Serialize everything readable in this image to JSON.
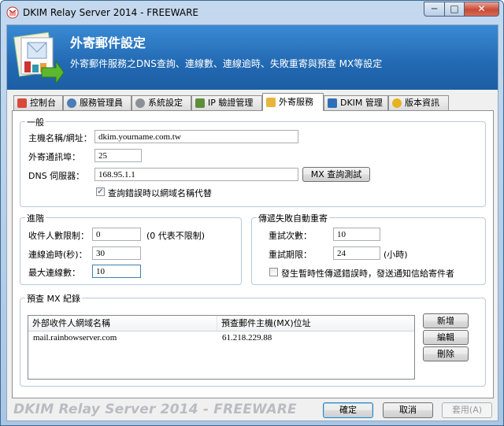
{
  "window": {
    "title": "DKIM Relay Server 2014 - FREEWARE",
    "min_glyph": "─",
    "max_glyph": "□",
    "close_glyph": "✕"
  },
  "banner": {
    "title": "外寄郵件設定",
    "subtitle": "外寄郵件服務之DNS查詢、連線數、連線逾時、失敗重寄與預查 MX等設定"
  },
  "tabs": [
    {
      "label": "控制台",
      "icon": "console-icon"
    },
    {
      "label": "服務管理員",
      "icon": "service-manager-icon"
    },
    {
      "label": "系統設定",
      "icon": "gear-icon"
    },
    {
      "label": "IP 驗證管理",
      "icon": "ip-verify-icon"
    },
    {
      "label": "外寄服務",
      "icon": "outgoing-service-icon",
      "active": true
    },
    {
      "label": "DKIM 管理",
      "icon": "dkim-icon"
    },
    {
      "label": "版本資訊",
      "icon": "version-info-icon"
    }
  ],
  "general": {
    "group_title": "一般",
    "hostname_label": "主機名稱/網址：",
    "hostname_value": "dkim.yourname.com.tw",
    "port_label": "外寄通訊埠：",
    "port_value": "25",
    "dns_label": "DNS 伺服器：",
    "dns_value": "168.95.1.1",
    "mx_test_button": "MX 查詢測試",
    "domain_fallback_label": "查詢錯誤時以網域名稱代替",
    "domain_fallback_checked": true
  },
  "advanced": {
    "group_title": "進階",
    "recipient_limit_label": "收件人數限制：",
    "recipient_limit_value": "0",
    "recipient_limit_hint": "(0 代表不限制)",
    "timeout_label": "連線逾時(秒)：",
    "timeout_value": "30",
    "max_conn_label": "最大連線數：",
    "max_conn_value": "10"
  },
  "retry": {
    "group_title": "傳遞失敗自動重寄",
    "retry_count_label": "重試次數：",
    "retry_count_value": "10",
    "retry_period_label": "重試期限：",
    "retry_period_value": "24",
    "retry_period_unit": "(小時)",
    "notify_label": "發生暫時性傳遞錯誤時，發送通知信給寄件者",
    "notify_checked": false
  },
  "mx_records": {
    "group_title": "預查 MX 紀錄",
    "columns": [
      "外部收件人網域名稱",
      "預查郵件主機(MX)位址"
    ],
    "rows": [
      [
        "mail.rainbowserver.com",
        "61.218.229.88"
      ]
    ],
    "add_button": "新增",
    "edit_button": "編輯",
    "delete_button": "刪除"
  },
  "footer": {
    "brand": "DKIM Relay Server 2014 - FREEWARE",
    "ok_button": "確定",
    "cancel_button": "取消",
    "apply_button": "套用(A)"
  }
}
